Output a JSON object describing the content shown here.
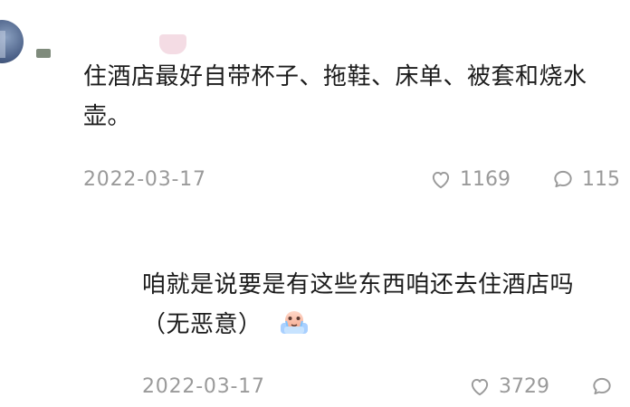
{
  "comments": [
    {
      "text": "住酒店最好自带杯子、拖鞋、床单、被套和烧水壶。",
      "date": "2022-03-17",
      "likes": "1169",
      "replies": "115"
    },
    {
      "text": "咱就是说要是有这些东西咱还去住酒店吗（无恶意）",
      "date": "2022-03-17",
      "likes": "3729",
      "replies": ""
    }
  ],
  "icons": {
    "like": "heart-icon",
    "reply": "comment-bubble-icon",
    "emoji": "crying-emoji-icon"
  },
  "colors": {
    "text": "#1c1c1c",
    "meta": "#9a9a9a",
    "background": "#ffffff"
  }
}
